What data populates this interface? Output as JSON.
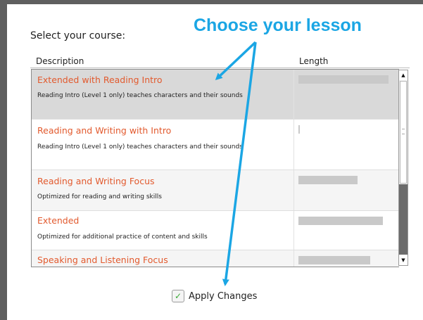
{
  "annotation": {
    "text": "Choose your lesson",
    "color": "#1ba6e4"
  },
  "dialog": {
    "prompt": "Select your course:"
  },
  "table": {
    "headers": {
      "description": "Description",
      "length": "Length"
    },
    "rows": [
      {
        "title": "Extended with Reading Intro",
        "subtitle": "Reading Intro (Level 1 only) teaches characters and their sounds",
        "selected": true
      },
      {
        "title": "Reading and Writing with Intro",
        "subtitle": "Reading Intro (Level 1 only) teaches characters and their sounds",
        "selected": false
      },
      {
        "title": "Reading and Writing Focus",
        "subtitle": "Optimized for reading and writing skills",
        "selected": false
      },
      {
        "title": "Extended",
        "subtitle": "Optimized for additional practice of content and skills",
        "selected": false
      },
      {
        "title": "Speaking and Listening Focus",
        "subtitle": "",
        "selected": false
      }
    ]
  },
  "scrollbar": {
    "up_icon": "triangle-up-icon",
    "down_icon": "triangle-down-icon"
  },
  "apply": {
    "label": "Apply Changes",
    "checked": true,
    "icon": "checkmark-icon"
  },
  "colors": {
    "accent": "#e25a2e",
    "check": "#39a935",
    "selected_row": "#d9d9d9"
  }
}
